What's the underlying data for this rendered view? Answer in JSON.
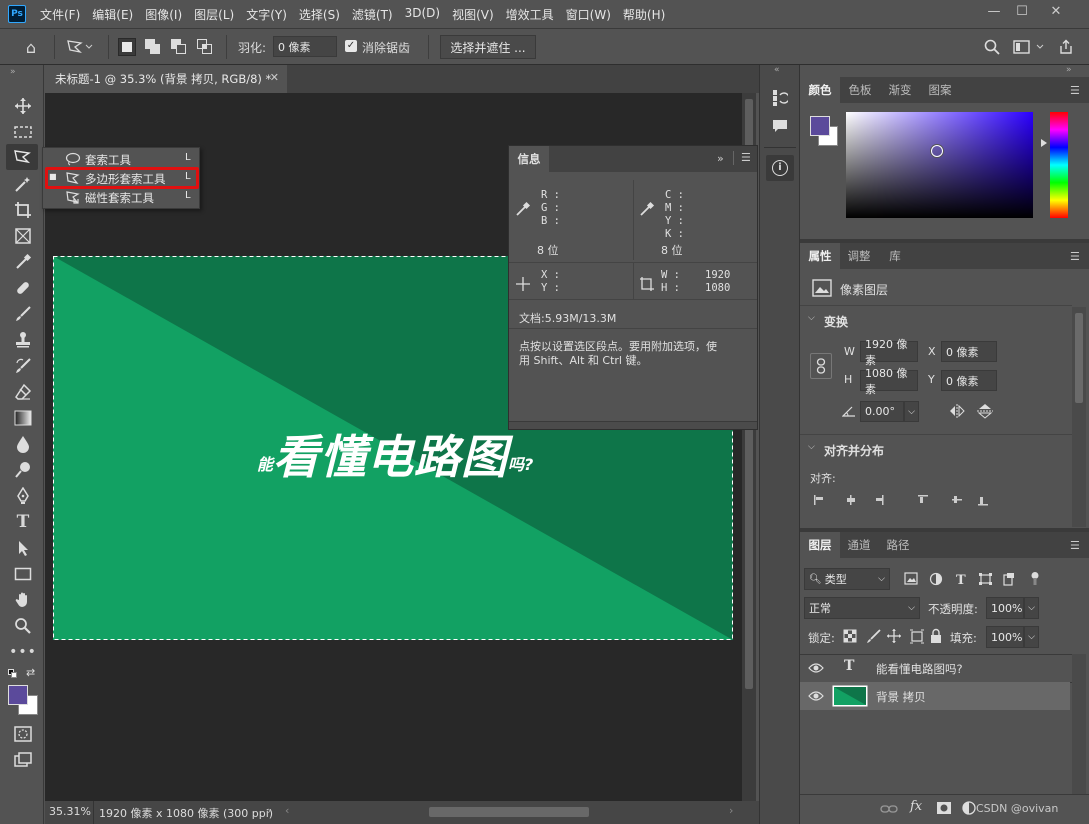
{
  "app": {
    "logo": "Ps"
  },
  "menus": [
    "文件(F)",
    "编辑(E)",
    "图像(I)",
    "图层(L)",
    "文字(Y)",
    "选择(S)",
    "滤镜(T)",
    "3D(D)",
    "视图(V)",
    "增效工具",
    "窗口(W)",
    "帮助(H)"
  ],
  "options": {
    "feather_label": "羽化:",
    "feather_value": "0 像素",
    "antialias_label": "消除锯齿",
    "select_mask_label": "选择并遮住 ..."
  },
  "document": {
    "tab_title": "未标题-1 @ 35.3% (背景 拷贝, RGB/8) *",
    "zoom": "35.31%",
    "size_info": "1920 像素 x 1080 像素 (300 ppi)",
    "canvas_text_small_left": "能",
    "canvas_text_big": "看懂电路图",
    "canvas_text_small_right": "吗?",
    "colors": {
      "dark_green": "#0e7549",
      "light_green": "#12a163"
    }
  },
  "flyout": {
    "items": [
      {
        "label": "套索工具",
        "key": "L"
      },
      {
        "label": "多边形套索工具",
        "key": "L"
      },
      {
        "label": "磁性套索工具",
        "key": "L"
      }
    ]
  },
  "info": {
    "title": "信息",
    "r": "R :",
    "g": "G :",
    "b": "B :",
    "bits1": "8 位",
    "c": "C :",
    "m": "M :",
    "y": "Y :",
    "k": "K :",
    "bits2": "8 位",
    "x": "X :",
    "yy": "Y :",
    "w": "W :",
    "w_val": "1920",
    "h": "H :",
    "h_val": "1080",
    "doc": "文档:5.93M/13.3M",
    "hint_line1": "点按以设置选区段点。要用附加选项，使",
    "hint_line2": "用 Shift、Alt 和 Ctrl 键。"
  },
  "color_panel": {
    "tabs": [
      "颜色",
      "色板",
      "渐变",
      "图案"
    ],
    "fg": "#5b4a9b",
    "bg": "#ffffff",
    "hue": "#2b00ff"
  },
  "properties": {
    "tabs": [
      "属性",
      "调整",
      "库"
    ],
    "type_label": "像素图层",
    "transform_title": "变换",
    "w_label": "W",
    "w_val": "1920 像素",
    "x_label": "X",
    "x_val": "0 像素",
    "h_label": "H",
    "h_val": "1080 像素",
    "y_label": "Y",
    "y_val": "0 像素",
    "angle": "0.00°",
    "align_title": "对齐并分布",
    "align_label": "对齐:"
  },
  "layers": {
    "tabs": [
      "图层",
      "通道",
      "路径"
    ],
    "filter": "类型",
    "blend": "正常",
    "opacity_label": "不透明度:",
    "opacity": "100%",
    "lock_label": "锁定:",
    "fill_label": "填充:",
    "fill": "100%",
    "items": [
      {
        "name": "能看懂电路图吗?",
        "type": "text"
      },
      {
        "name": "背景 拷贝",
        "type": "pixel"
      }
    ],
    "fx": "fx",
    "watermark": "CSDN @ovivan"
  }
}
